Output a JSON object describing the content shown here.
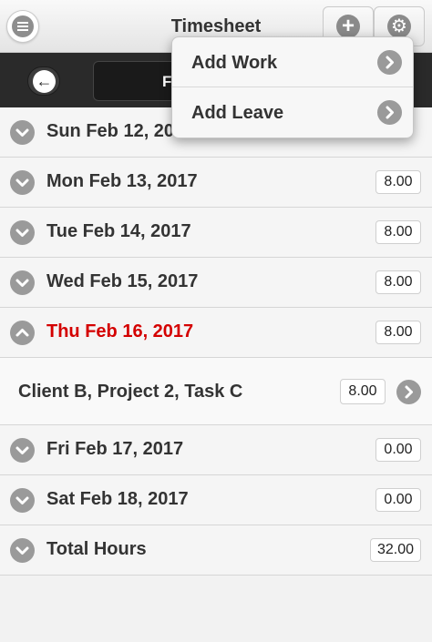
{
  "header": {
    "title": "Timesheet",
    "menu_icon": "menu-icon",
    "add_icon": "plus-icon",
    "settings_icon": "gear-icon"
  },
  "subbar": {
    "back_icon": "arrow-left-icon",
    "range_label": "F"
  },
  "days": [
    {
      "label": "Sun Feb 12, 20",
      "hours": "",
      "expanded": false,
      "today": false
    },
    {
      "label": "Mon Feb 13, 2017",
      "hours": "8.00",
      "expanded": false,
      "today": false
    },
    {
      "label": "Tue Feb 14, 2017",
      "hours": "8.00",
      "expanded": false,
      "today": false
    },
    {
      "label": "Wed Feb 15, 2017",
      "hours": "8.00",
      "expanded": false,
      "today": false
    },
    {
      "label": "Thu Feb 16, 2017",
      "hours": "8.00",
      "expanded": true,
      "today": true
    }
  ],
  "entry": {
    "label": "Client B, Project 2, Task C",
    "hours": "8.00"
  },
  "days_after": [
    {
      "label": "Fri Feb 17, 2017",
      "hours": "0.00"
    },
    {
      "label": "Sat Feb 18, 2017",
      "hours": "0.00"
    }
  ],
  "total": {
    "label": "Total Hours",
    "hours": "32.00"
  },
  "popup": {
    "items": [
      {
        "label": "Add Work"
      },
      {
        "label": "Add Leave"
      }
    ]
  },
  "colors": {
    "today": "#d40000",
    "header_dark": "#2a2a2a",
    "icon_grey": "#9a9a9a"
  }
}
